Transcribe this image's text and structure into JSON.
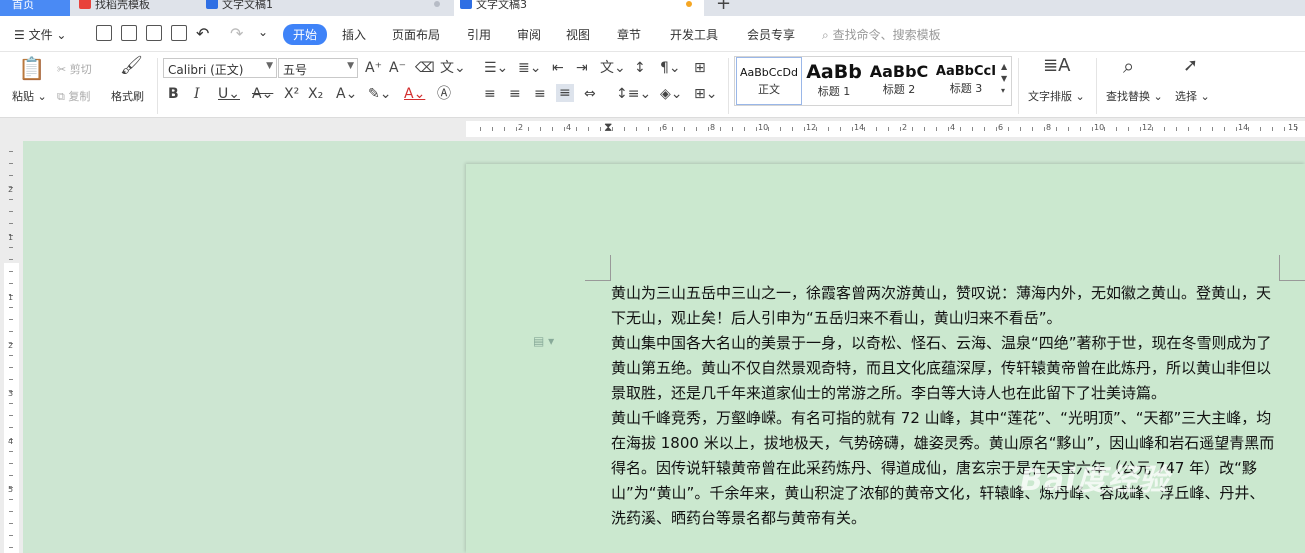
{
  "tabs": {
    "home": "首页",
    "t2": "找稻壳模板",
    "t3": "文字文稿1",
    "t4": "文字文稿3"
  },
  "colors": {
    "accent": "#3f83f8",
    "page_bg": "#cbe8cf",
    "modified_dot": "#f5a623"
  },
  "menu": {
    "file": "文件",
    "items": [
      "开始",
      "插入",
      "页面布局",
      "引用",
      "审阅",
      "视图",
      "章节",
      "开发工具",
      "会员专享"
    ],
    "search": "查找命令、搜索模板"
  },
  "ribbon": {
    "paste": "粘贴",
    "cut": "剪切",
    "copy": "复制",
    "format_painter": "格式刷",
    "font_name": "Calibri (正文)",
    "font_size": "五号",
    "styles": [
      {
        "preview": "AaBbCcDd",
        "name": "正文"
      },
      {
        "preview": "AaBb",
        "name": "标题 1"
      },
      {
        "preview": "AaBbC",
        "name": "标题 2"
      },
      {
        "preview": "AaBbCcI",
        "name": "标题 3"
      }
    ],
    "text_layout": "文字排版",
    "find_replace": "查找替换",
    "select": "选择"
  },
  "ruler": {
    "h_numbers": [
      "2",
      "4",
      "6",
      "8",
      "10",
      "12",
      "14",
      "2",
      "4",
      "6",
      "8",
      "10",
      "12",
      "14",
      "15"
    ],
    "v_numbers": [
      "2",
      "1",
      "1",
      "2",
      "3",
      "4",
      "5"
    ]
  },
  "document": {
    "paragraphs": [
      "黄山为三山五岳中三山之一，徐霞客曾两次游黄山，赞叹说：薄海内外，无如徽之黄山。登黄山，天下无山，观止矣！后人引申为“五岳归来不看山，黄山归来不看岳”。",
      "黄山集中国各大名山的美景于一身，以奇松、怪石、云海、温泉“四绝”著称于世，现在冬雪则成为了黄山第五绝。黄山不仅自然景观奇特，而且文化底蕴深厚，传轩辕黄帝曾在此炼丹，所以黄山非但以景取胜，还是几千年来道家仙士的常游之所。李白等大诗人也在此留下了壮美诗篇。",
      "黄山千峰竞秀，万壑峥嵘。有名可指的就有 72 山峰，其中“莲花”、“光明顶”、“天都”三大主峰，均在海拔 1800 米以上，拔地极天，气势磅礴，雄姿灵秀。黄山原名“黟山”，因山峰和岩石遥望青黑而得名。因传说轩辕黄帝曾在此采药炼丹、得道成仙，唐玄宗于是在天宝六年（公元 747 年）改“黟山”为“黄山”。千余年来，黄山积淀了浓郁的黄帝文化，轩辕峰、炼丹峰、容成峰、浮丘峰、丹井、洗药溪、晒药台等景名都与黄帝有关。"
    ]
  },
  "watermark": "Bai度经验"
}
